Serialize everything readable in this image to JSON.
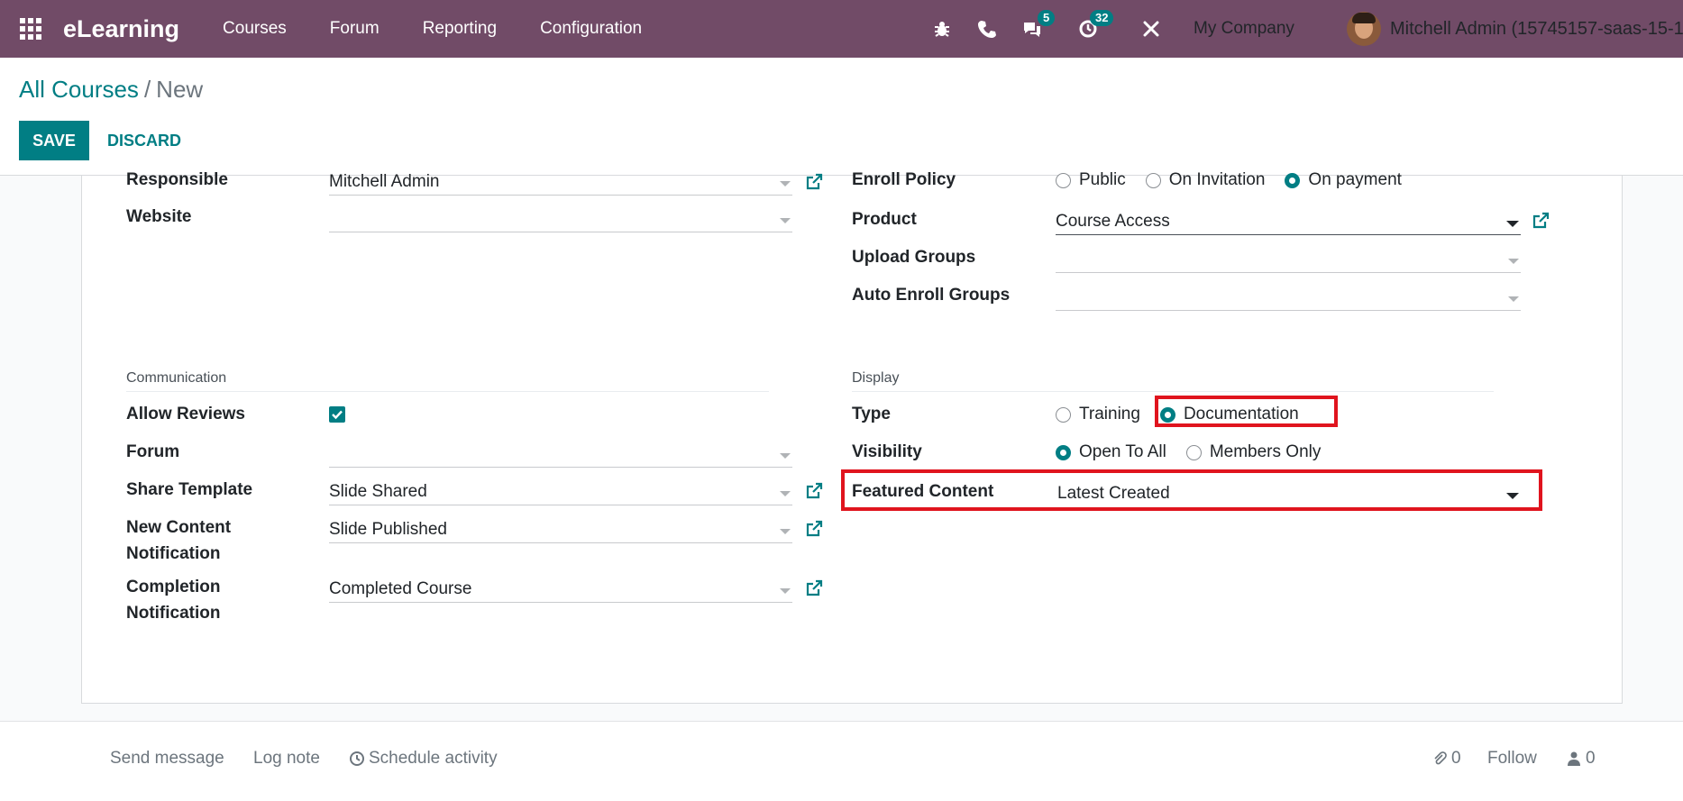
{
  "navbar": {
    "app_name": "eLearning",
    "menu": [
      "Courses",
      "Forum",
      "Reporting",
      "Configuration"
    ],
    "messages_count": "5",
    "activities_count": "32",
    "company": "My Company",
    "user": "Mitchell Admin (15745157-saas-15-1-",
    "brand_color": "#714b67"
  },
  "control": {
    "breadcrumb_parent": "All Courses",
    "breadcrumb_sep": "/",
    "breadcrumb_current": "New",
    "save_label": "SAVE",
    "discard_label": "DISCARD"
  },
  "left": {
    "responsible_label": "Responsible",
    "responsible_value": "Mitchell Admin",
    "website_label": "Website",
    "website_value": "",
    "communication_title": "Communication",
    "allow_reviews_label": "Allow Reviews",
    "allow_reviews_checked": true,
    "forum_label": "Forum",
    "forum_value": "",
    "share_template_label": "Share Template",
    "share_template_value": "Slide Shared",
    "new_content_label_1": "New Content",
    "new_content_label_2": "Notification",
    "new_content_value": "Slide Published",
    "completion_label_1": "Completion",
    "completion_label_2": "Notification",
    "completion_value": "Completed Course"
  },
  "right": {
    "enroll_policy_label": "Enroll Policy",
    "enroll_options": [
      "Public",
      "On Invitation",
      "On payment"
    ],
    "enroll_selected": "On payment",
    "product_label": "Product",
    "product_value": "Course Access",
    "upload_groups_label": "Upload Groups",
    "upload_groups_value": "",
    "auto_enroll_label": "Auto Enroll Groups",
    "auto_enroll_value": "",
    "display_title": "Display",
    "type_label": "Type",
    "type_options": [
      "Training",
      "Documentation"
    ],
    "type_selected": "Documentation",
    "visibility_label": "Visibility",
    "visibility_options": [
      "Open To All",
      "Members Only"
    ],
    "visibility_selected": "Open To All",
    "featured_label": "Featured Content",
    "featured_value": "Latest Created"
  },
  "chatter": {
    "send_message": "Send message",
    "log_note": "Log note",
    "schedule_activity": "Schedule activity",
    "attachments_count": "0",
    "follow": "Follow",
    "followers_count": "0"
  },
  "colors": {
    "accent": "#017e84",
    "highlight": "#e0141e"
  }
}
